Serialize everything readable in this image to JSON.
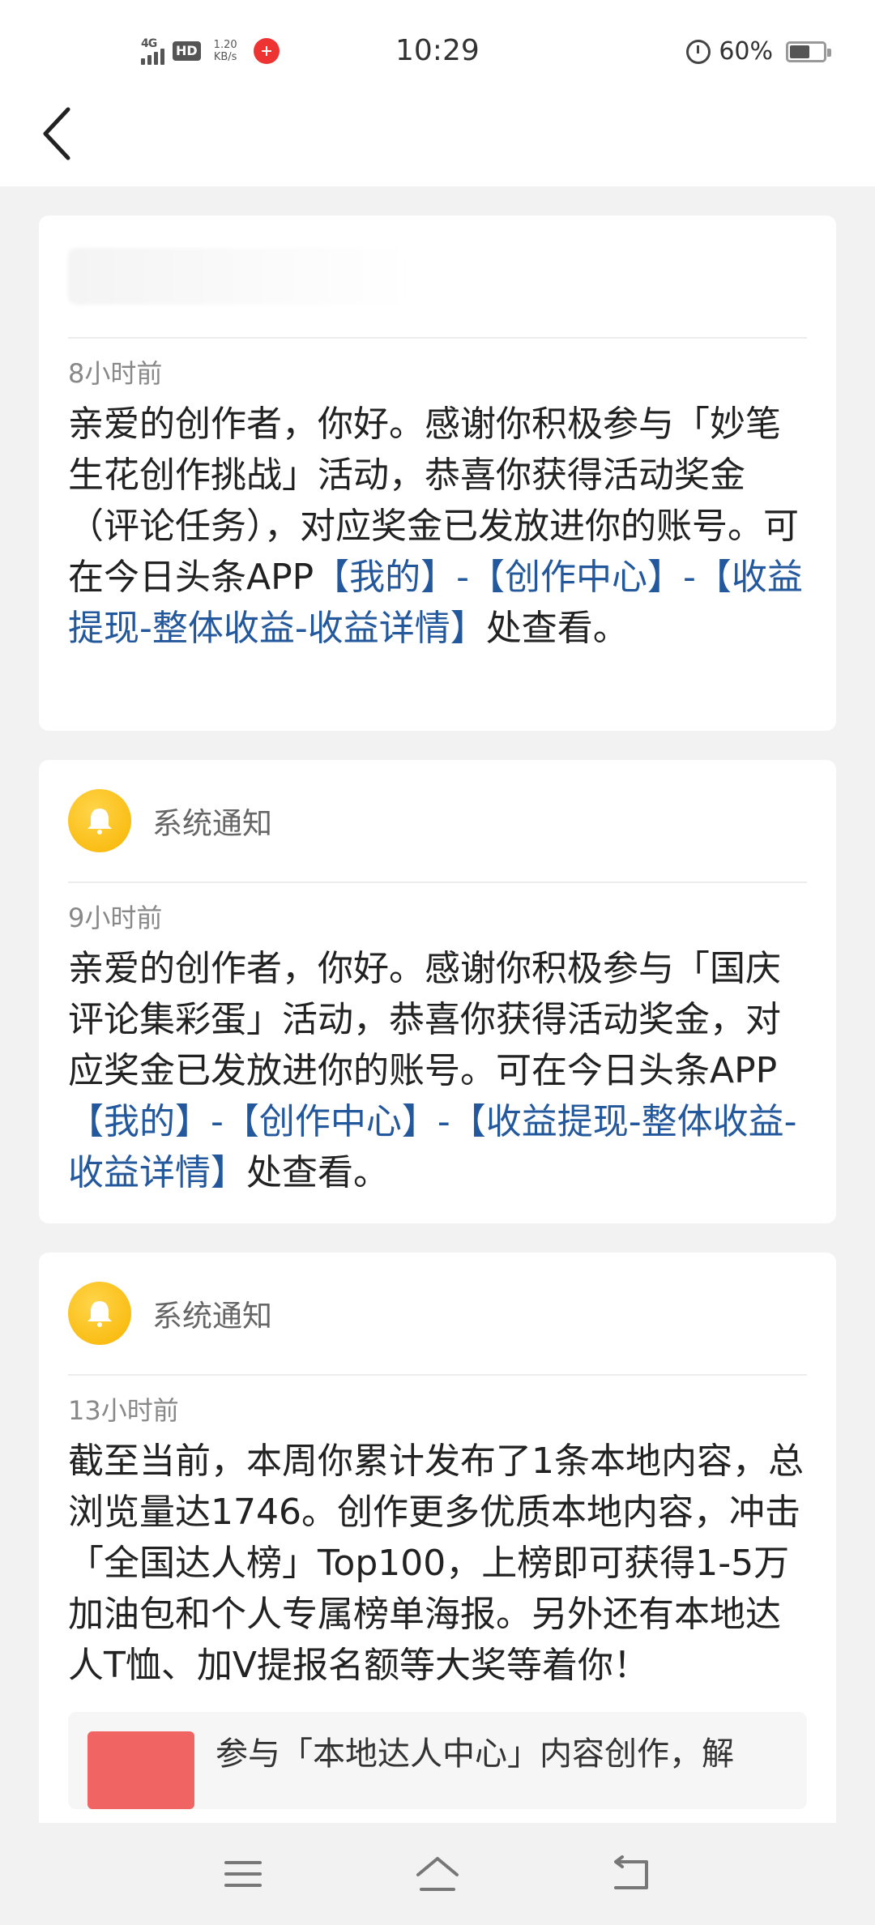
{
  "status_bar": {
    "network": "4G",
    "hd": "HD",
    "speed_value": "1.20",
    "speed_unit": "KB/s",
    "time": "10:29",
    "battery_percent": "60%",
    "battery_level": 0.6
  },
  "messages": [
    {
      "sender": "",
      "time": "8小时前",
      "body": [
        {
          "text": "亲爱的创作者，你好。感谢你积极参与「妙笔生花创作挑战」活动，恭喜你获得活动奖金（评论任务），对应奖金已发放进你的账号。可在今日头条APP",
          "link": false
        },
        {
          "text": "【我的】-【创作中心】-【收益提现-整体收益-收益详情】",
          "link": true
        },
        {
          "text": "处查看。",
          "link": false
        }
      ]
    },
    {
      "sender": "系统通知",
      "time": "9小时前",
      "body": [
        {
          "text": "亲爱的创作者，你好。感谢你积极参与「国庆评论集彩蛋」活动，恭喜你获得活动奖金，对应奖金已发放进你的账号。可在今日头条APP",
          "link": false
        },
        {
          "text": "【我的】-【创作中心】-【收益提现-整体收益-收益详情】",
          "link": true
        },
        {
          "text": "处查看。",
          "link": false
        }
      ]
    },
    {
      "sender": "系统通知",
      "time": "13小时前",
      "body": [
        {
          "text": "截至当前，本周你累计发布了1条本地内容，总浏览量达1746。创作更多优质本地内容，冲击「全国达人榜」Top100，上榜即可获得1-5万加油包和个人专属榜单海报。另外还有本地达人T恤、加V提报名额等大奖等着你！",
          "link": false
        }
      ],
      "preview_title": "参与「本地达人中心」内容创作，解"
    }
  ],
  "icons": {
    "back": "chevron-left-icon",
    "bell": "bell-icon",
    "menu": "menu-icon",
    "home": "home-icon",
    "return": "back-arrow-icon"
  },
  "colors": {
    "link": "#24589c",
    "bell": "#f8b400",
    "preview_thumb": "#f06464"
  }
}
